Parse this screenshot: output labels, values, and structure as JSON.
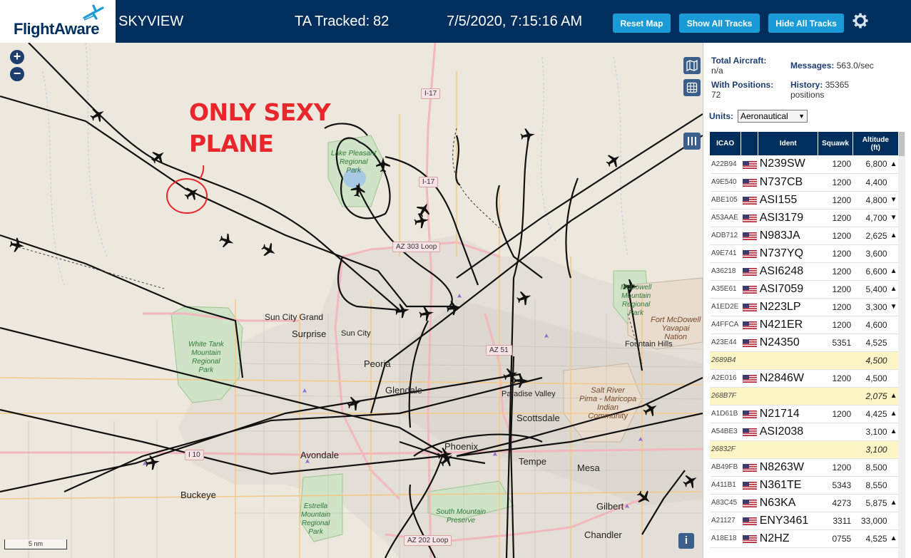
{
  "header": {
    "logo_text": "FlightAware",
    "app_title": "SKYVIEW",
    "ta_label": "TA Tracked:",
    "ta_value": "82",
    "datetime": "7/5/2020, 7:15:16 AM",
    "buttons": {
      "reset_map": "Reset Map",
      "show_all_tracks": "Show All Tracks",
      "hide_all_tracks": "Hide All Tracks"
    },
    "settings_icon": "gear-icon"
  },
  "map": {
    "zoom_in": "+",
    "zoom_out": "−",
    "scale_label": "5 nm",
    "info_button": "i",
    "annotation": [
      "ONLY SEXY",
      "PLANE"
    ],
    "annotation_color": "#e8262c",
    "places": [
      "Sun City Grand",
      "Surprise",
      "Sun City",
      "Peoria",
      "Glendale",
      "Paradise Valley",
      "Scottsdale",
      "Phoenix",
      "Tempe",
      "Mesa",
      "Gilbert",
      "Chandler",
      "Avondale",
      "Buckeye",
      "Fountain Hills"
    ],
    "parks": {
      "lake_pleasant": [
        "Lake Pleasant",
        "Regional",
        "Park"
      ],
      "white_tank": [
        "White Tank",
        "Mountain",
        "Regional",
        "Park"
      ],
      "estrella": [
        "Estrella",
        "Mountain",
        "Regional",
        "Park"
      ],
      "south_mountain": [
        "South Mountain",
        "Preserve"
      ],
      "mcdowell": [
        "McDowell",
        "Mountain",
        "Regional",
        "Park"
      ]
    },
    "reserves": {
      "fort_mcdowell": [
        "Fort McDowell",
        "Yavapai",
        "Nation"
      ],
      "salt_river": [
        "Salt River",
        "Pima - Maricopa",
        "Indian",
        "Community"
      ]
    },
    "highways": [
      "I-17",
      "AZ 303 Loop",
      "I 10",
      "AZ 51",
      "AZ 202 Loop",
      "I-17"
    ]
  },
  "panel": {
    "total_aircraft_label": "Total Aircraft:",
    "total_aircraft_value": "n/a",
    "with_positions_label": "With Positions:",
    "with_positions_value": "72",
    "messages_label": "Messages:",
    "messages_value": "563.0/sec",
    "history_label": "History:",
    "history_value": "35365",
    "history_unit": "positions",
    "units_label": "Units:",
    "units_value": "Aeronautical",
    "columns": {
      "icao": "ICAO",
      "ident": "Ident",
      "squawk": "Squawk",
      "altitude": "Altitude",
      "altitude_unit": "(ft)"
    },
    "rows": [
      {
        "icao": "A22B94",
        "flag": "us",
        "ident": "N239SW",
        "squawk": "1200",
        "alt": "6,800",
        "trend": "▲"
      },
      {
        "icao": "A9E540",
        "flag": "us",
        "ident": "N737CB",
        "squawk": "1200",
        "alt": "4,400",
        "trend": ""
      },
      {
        "icao": "ABE105",
        "flag": "us",
        "ident": "ASI155",
        "squawk": "1200",
        "alt": "4,800",
        "trend": "▼"
      },
      {
        "icao": "A53AAE",
        "flag": "us",
        "ident": "ASI3179",
        "squawk": "1200",
        "alt": "4,700",
        "trend": "▼"
      },
      {
        "icao": "ADB712",
        "flag": "us",
        "ident": "N983JA",
        "squawk": "1200",
        "alt": "2,625",
        "trend": "▲"
      },
      {
        "icao": "A9E741",
        "flag": "us",
        "ident": "N737YQ",
        "squawk": "1200",
        "alt": "3,600",
        "trend": ""
      },
      {
        "icao": "A36218",
        "flag": "us",
        "ident": "ASI6248",
        "squawk": "1200",
        "alt": "6,600",
        "trend": "▲"
      },
      {
        "icao": "A35E61",
        "flag": "us",
        "ident": "ASI7059",
        "squawk": "1200",
        "alt": "5,400",
        "trend": "▲"
      },
      {
        "icao": "A1ED2E",
        "flag": "us",
        "ident": "N223LP",
        "squawk": "1200",
        "alt": "3,300",
        "trend": "▼"
      },
      {
        "icao": "A4FFCA",
        "flag": "us",
        "ident": "N421ER",
        "squawk": "1200",
        "alt": "4,600",
        "trend": ""
      },
      {
        "icao": "A23E44",
        "flag": "us",
        "ident": "N24350",
        "squawk": "5351",
        "alt": "4,525",
        "trend": ""
      },
      {
        "icao": "2689B4",
        "flag": "",
        "ident": "",
        "squawk": "",
        "alt": "4,500",
        "trend": ""
      },
      {
        "icao": "A2E016",
        "flag": "us",
        "ident": "N2846W",
        "squawk": "1200",
        "alt": "4,500",
        "trend": ""
      },
      {
        "icao": "268B7F",
        "flag": "",
        "ident": "",
        "squawk": "",
        "alt": "2,075",
        "trend": "▲"
      },
      {
        "icao": "A1D61B",
        "flag": "us",
        "ident": "N21714",
        "squawk": "1200",
        "alt": "4,425",
        "trend": "▲"
      },
      {
        "icao": "A54BE3",
        "flag": "us",
        "ident": "ASI2038",
        "squawk": "",
        "alt": "3,100",
        "trend": "▲"
      },
      {
        "icao": "26832F",
        "flag": "",
        "ident": "",
        "squawk": "",
        "alt": "3,100",
        "trend": ""
      },
      {
        "icao": "AB49FB",
        "flag": "us",
        "ident": "N8263W",
        "squawk": "1200",
        "alt": "8,500",
        "trend": ""
      },
      {
        "icao": "A411B1",
        "flag": "us",
        "ident": "N361TE",
        "squawk": "5343",
        "alt": "8,550",
        "trend": ""
      },
      {
        "icao": "A83C45",
        "flag": "us",
        "ident": "N63KA",
        "squawk": "4273",
        "alt": "5,875",
        "trend": "▲"
      },
      {
        "icao": "A21127",
        "flag": "us",
        "ident": "ENY3461",
        "squawk": "3311",
        "alt": "33,000",
        "trend": ""
      },
      {
        "icao": "A18E18",
        "flag": "us",
        "ident": "N2HZ",
        "squawk": "0755",
        "alt": "4,525",
        "trend": "▲"
      }
    ]
  }
}
